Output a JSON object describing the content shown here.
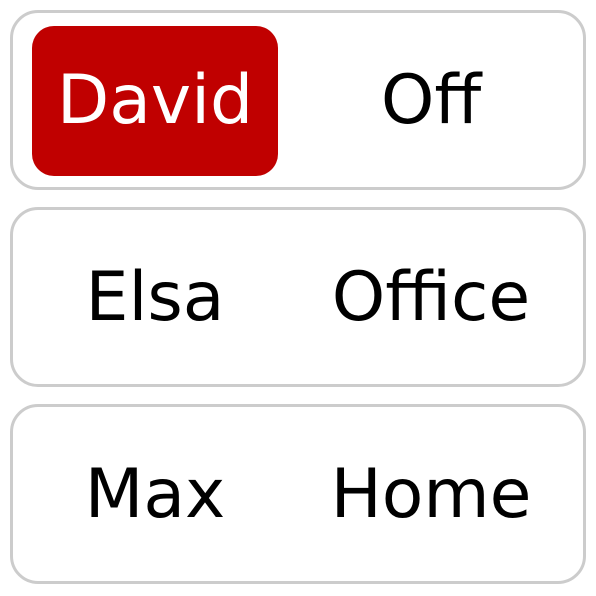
{
  "colors": {
    "selected_background": "#c00000",
    "selected_text": "#ffffff",
    "row_border": "#cccccc",
    "text": "#000000"
  },
  "rows": [
    {
      "name": "David",
      "status": "Off",
      "selected": true
    },
    {
      "name": "Elsa",
      "status": "Office",
      "selected": false
    },
    {
      "name": "Max",
      "status": "Home",
      "selected": false
    }
  ]
}
